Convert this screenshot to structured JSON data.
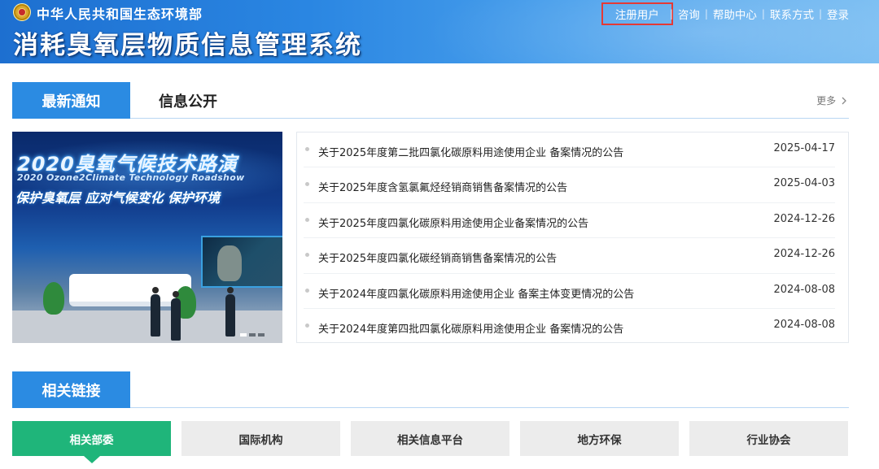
{
  "header": {
    "ministry": "中华人民共和国生态环境部",
    "title": "消耗臭氧层物质信息管理系统",
    "nav": [
      {
        "label": "注册用户"
      },
      {
        "label": "咨询"
      },
      {
        "label": "帮助中心"
      },
      {
        "label": "联系方式"
      },
      {
        "label": "登录"
      }
    ],
    "nav_separator": "|",
    "highlight_color": "#e53935"
  },
  "news_section": {
    "active_tab": "最新通知",
    "tab2": "信息公开",
    "more": "更多",
    "more_icon": "chevron-right-icon"
  },
  "banner": {
    "line1": "2020臭氧气候技术路演",
    "line2": "2020 Ozone2Climate Technology Roadshow",
    "line3": "保护臭氧层 应对气候变化 保护环境"
  },
  "news": [
    {
      "title": "关于2025年度第二批四氯化碳原料用途使用企业 备案情况的公告",
      "date": "2025-04-17"
    },
    {
      "title": "关于2025年度含氢氯氟烃经销商销售备案情况的公告",
      "date": "2025-04-03"
    },
    {
      "title": "关于2025年度四氯化碳原料用途使用企业备案情况的公告",
      "date": "2024-12-26"
    },
    {
      "title": "关于2025年度四氯化碳经销商销售备案情况的公告",
      "date": "2024-12-26"
    },
    {
      "title": "关于2024年度四氯化碳原料用途使用企业 备案主体变更情况的公告",
      "date": "2024-08-08"
    },
    {
      "title": "关于2024年度第四批四氯化碳原料用途使用企业 备案情况的公告",
      "date": "2024-08-08"
    }
  ],
  "links_section": {
    "title": "相关链接",
    "buttons": [
      {
        "label": "相关部委"
      },
      {
        "label": "国际机构"
      },
      {
        "label": "相关信息平台"
      },
      {
        "label": "地方环保"
      },
      {
        "label": "行业协会"
      }
    ]
  },
  "colors": {
    "header_blue": "#2a86e2",
    "tab_blue": "#2b8be2",
    "link_active_green": "#1fb57a",
    "link_inactive_gray": "#ececec"
  }
}
